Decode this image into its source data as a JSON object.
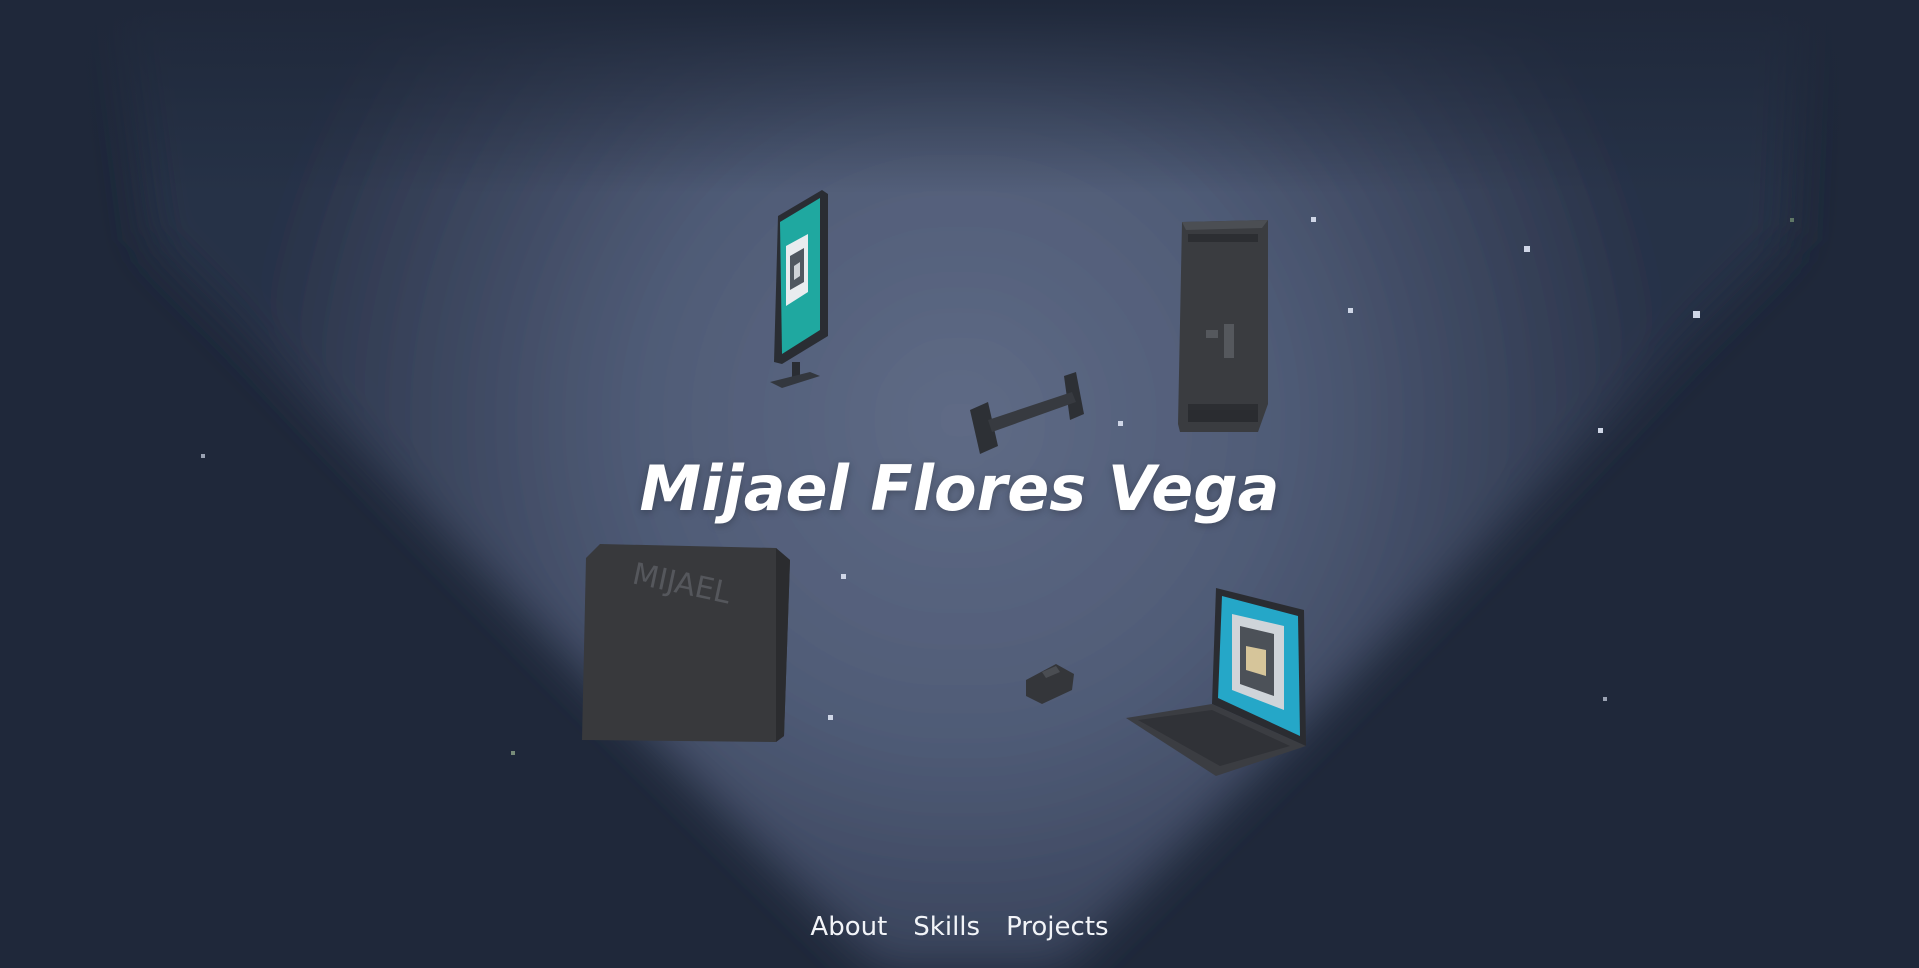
{
  "hero": {
    "name": "Mijael Flores Vega"
  },
  "nav": {
    "items": [
      {
        "label": "About"
      },
      {
        "label": "Skills"
      },
      {
        "label": "Projects"
      }
    ]
  },
  "scene_objects": {
    "monitor": "monitor-icon",
    "server_rack": "server-rack-icon",
    "dumbbell": "dumbbell-icon",
    "box": "box-icon",
    "box_text": "MIJAEL",
    "mouse": "mouse-icon",
    "laptop": "laptop-icon"
  },
  "colors": {
    "background": "#1f283a",
    "spotlight": "#a7b3cf",
    "accent_screen": "#1fa8a0",
    "text": "#ffffff"
  }
}
